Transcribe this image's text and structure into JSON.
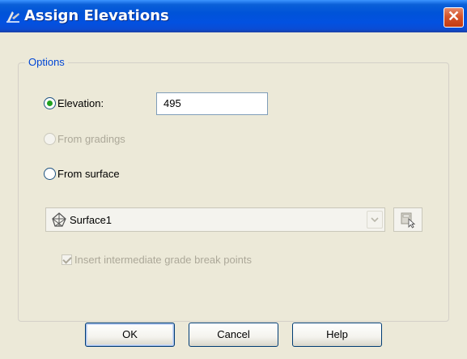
{
  "window": {
    "title": "Assign Elevations",
    "close_glyph": "✕",
    "title_icon": "autocad-icon",
    "colors": {
      "title_bar": "#0053d8",
      "close_button": "#d6552b",
      "accent_text": "#0046d5",
      "background": "#ece9d8"
    }
  },
  "options": {
    "group_title": "Options",
    "elevation": {
      "label": "Elevation:",
      "selected": true,
      "value": "495"
    },
    "from_gradings": {
      "label": "From gradings",
      "selected": false,
      "enabled": false
    },
    "from_surface": {
      "label": "From surface",
      "selected": false,
      "enabled": true
    },
    "surface_select": {
      "value": "Surface1",
      "enabled": false,
      "icon": "surface-tin-icon"
    },
    "pick_button": {
      "icon": "pick-from-drawing-icon",
      "enabled": false
    },
    "grade_break": {
      "label": "Insert intermediate grade break points",
      "checked": true,
      "enabled": false
    }
  },
  "buttons": {
    "ok": "OK",
    "cancel": "Cancel",
    "help": "Help"
  }
}
